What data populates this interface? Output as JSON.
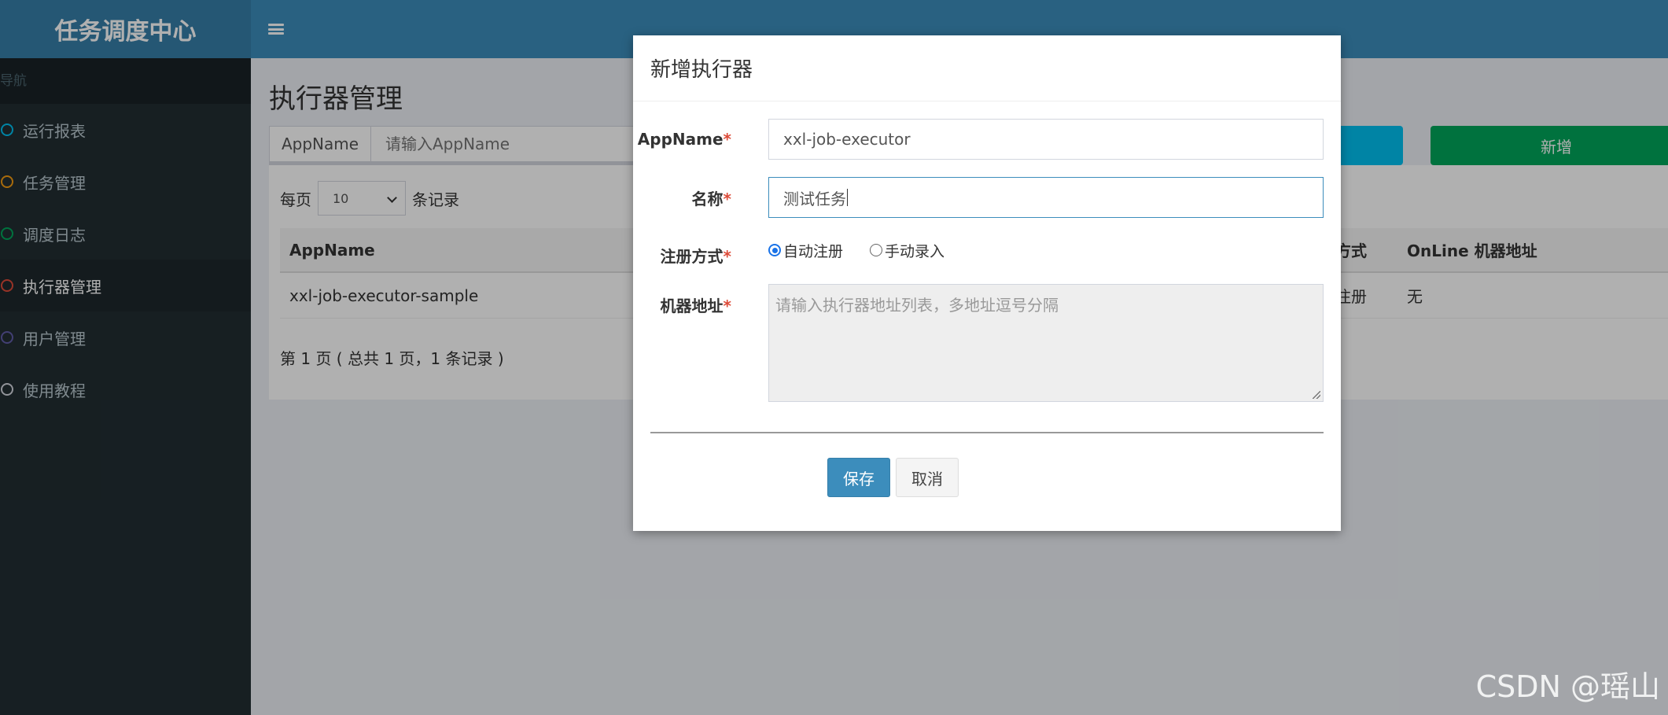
{
  "app": {
    "title": "任务调度中心"
  },
  "sidebar": {
    "header": "导航",
    "items": [
      {
        "label": "运行报表",
        "color": "#00c0ef"
      },
      {
        "label": "任务管理",
        "color": "#f39c12"
      },
      {
        "label": "调度日志",
        "color": "#00a65a"
      },
      {
        "label": "执行器管理",
        "color": "#dd4b39",
        "active": true
      },
      {
        "label": "用户管理",
        "color": "#605ca8"
      },
      {
        "label": "使用教程",
        "color": "#d2d6de"
      }
    ]
  },
  "page": {
    "title": "执行器管理",
    "search": {
      "addon": "AppName",
      "placeholder": "请输入AppName"
    },
    "add_label": "新增",
    "length": {
      "prefix": "每页",
      "value": "10",
      "suffix": "条记录"
    },
    "table": {
      "headers": [
        "AppName",
        "方式",
        "OnLine 机器地址"
      ],
      "rows": [
        [
          "xxl-job-executor-sample",
          "注册",
          "无"
        ]
      ]
    },
    "page_info": "第 1 页 ( 总共 1 页，1 条记录 )"
  },
  "modal": {
    "title": "新增执行器",
    "fields": {
      "appname": {
        "label": "AppName",
        "value": "xxl-job-executor"
      },
      "name": {
        "label": "名称",
        "value": "测试任务"
      },
      "register": {
        "label": "注册方式",
        "options": [
          "自动注册",
          "手动录入"
        ],
        "selected": "自动注册"
      },
      "address": {
        "label": "机器地址",
        "placeholder": "请输入执行器地址列表，多地址逗号分隔"
      }
    },
    "required_mark": "*",
    "save_label": "保存",
    "cancel_label": "取消"
  },
  "watermark": "CSDN @瑶山",
  "colors": {
    "primary": "#3c8dbc",
    "success": "#00a65a",
    "info": "#00c0ef",
    "danger": "#dd4b39"
  }
}
